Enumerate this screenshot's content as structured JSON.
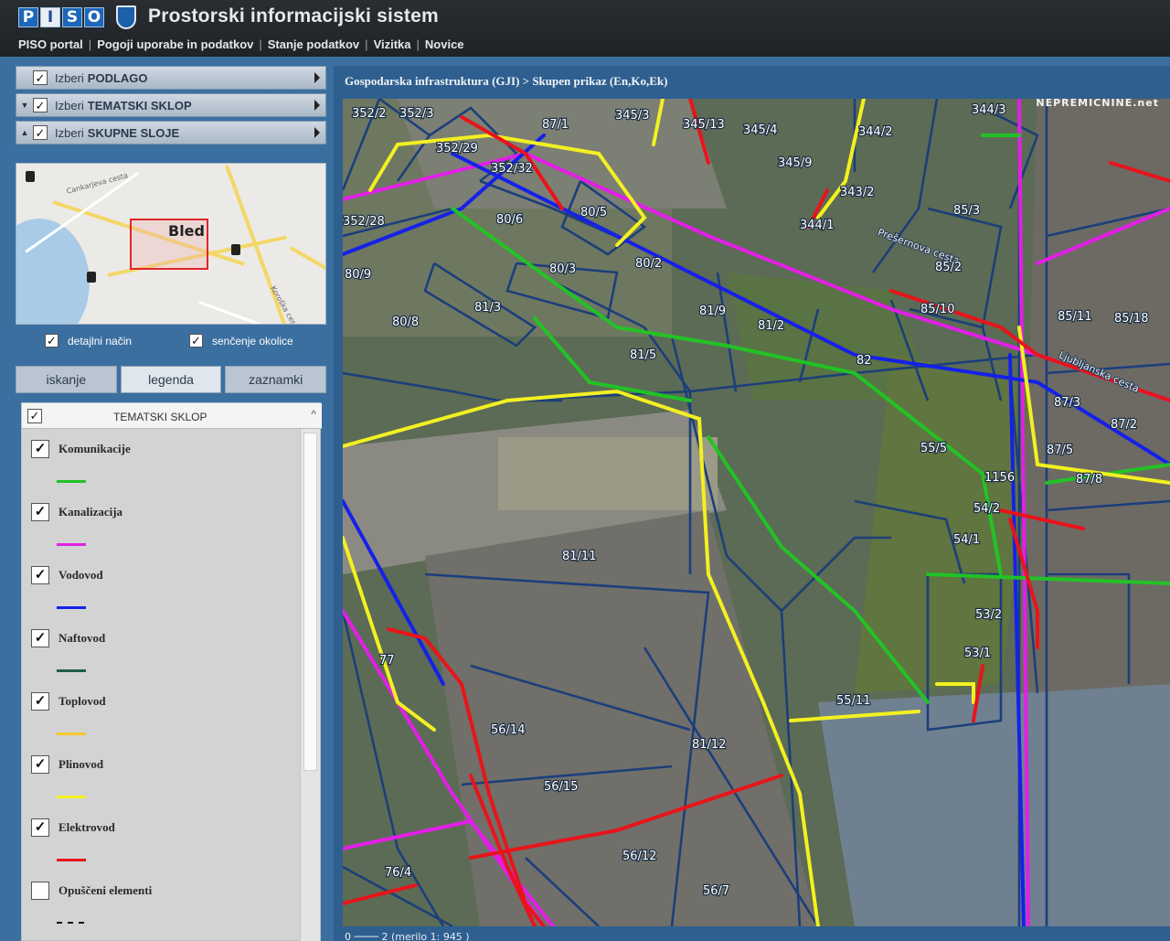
{
  "header": {
    "logo_letters": [
      "P",
      "I",
      "S",
      "O"
    ],
    "app_title": "Prostorski informacijski sistem",
    "nav": [
      "PISO portal",
      "Pogoji uporabe in podatkov",
      "Stanje podatkov",
      "Vizitka",
      "Novice"
    ]
  },
  "left": {
    "accordion": [
      {
        "prefix": "Izberi",
        "label": "PODLAGO",
        "expander": ""
      },
      {
        "prefix": "Izberi",
        "label": "TEMATSKI SKLOP",
        "expander": "▼"
      },
      {
        "prefix": "Izberi",
        "label": "SKUPNE SLOJE",
        "expander": "▲"
      }
    ],
    "overview_map": {
      "place_label": "Bled",
      "streets": [
        "Cankarjeva cesta",
        "Koroška cesta"
      ]
    },
    "options": [
      {
        "label": "detajlni način",
        "checked": true
      },
      {
        "label": "senčenje okolice",
        "checked": true
      }
    ],
    "tabs": [
      "iskanje",
      "legenda",
      "zaznamki"
    ],
    "active_tab": "legenda",
    "legend": {
      "title": "TEMATSKI SKLOP",
      "items": [
        {
          "label": "Komunikacije",
          "color": "#22c226",
          "checked": true
        },
        {
          "label": "Kanalizacija",
          "color": "#e21fe6",
          "checked": true
        },
        {
          "label": "Vodovod",
          "color": "#1521e8",
          "checked": true
        },
        {
          "label": "Naftovod",
          "color": "#1f5c4a",
          "checked": true
        },
        {
          "label": "Toplovod",
          "color": "#f2c92a",
          "checked": true
        },
        {
          "label": "Plinovod",
          "color": "#f3f021",
          "checked": true
        },
        {
          "label": "Elektrovod",
          "color": "#e8141a",
          "checked": true
        },
        {
          "label": "Opuščeni elementi",
          "color": "#111111",
          "checked": false
        }
      ]
    }
  },
  "map": {
    "breadcrumb": "Gospodarska infrastruktura (GJI) > Skupen prikaz (En,Ko,Ek)",
    "watermark": "NEPREMICNINE.net",
    "street_label": "Prešernova cesta",
    "street_label_2": "Ljubljanska cesta",
    "scale_text": "0 ──── 2 (merilo 1: 945 )",
    "plot_labels": [
      "352/2",
      "352/3",
      "87/1",
      "345/3",
      "345/13",
      "345/4",
      "344/2",
      "344/3",
      "352/29",
      "352/32",
      "345/9",
      "343/2",
      "85/3",
      "80/6",
      "80/5",
      "344/1",
      "352/28",
      "80/3",
      "80/2",
      "85/2",
      "85/10",
      "80/9",
      "81/3",
      "81/9",
      "81/2",
      "85/11",
      "85/18",
      "80/8",
      "81/5",
      "82",
      "87/3",
      "87/2",
      "55/5",
      "87/5",
      "1156",
      "87/8",
      "54/2",
      "54/1",
      "81/11",
      "53/2",
      "53/1",
      "55/11",
      "77",
      "56/14",
      "81/12",
      "56/15",
      "56/12",
      "76/4",
      "56/7"
    ]
  }
}
